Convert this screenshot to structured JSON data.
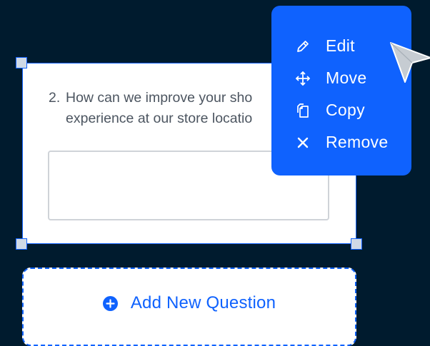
{
  "question": {
    "number": "2.",
    "text_line1": "How can we improve your sho",
    "text_line2": "experience at our store locatio",
    "answer_value": ""
  },
  "context_menu": {
    "items": [
      {
        "label": "Edit",
        "icon": "pencil-icon"
      },
      {
        "label": "Move",
        "icon": "move-icon"
      },
      {
        "label": "Copy",
        "icon": "copy-icon"
      },
      {
        "label": "Remove",
        "icon": "close-icon"
      }
    ]
  },
  "add_button": {
    "label": "Add New Question",
    "icon": "plus-circle-icon"
  },
  "colors": {
    "background": "#001b2e",
    "accent": "#0f62fe",
    "card": "#ffffff",
    "question_text": "#4c5560"
  }
}
